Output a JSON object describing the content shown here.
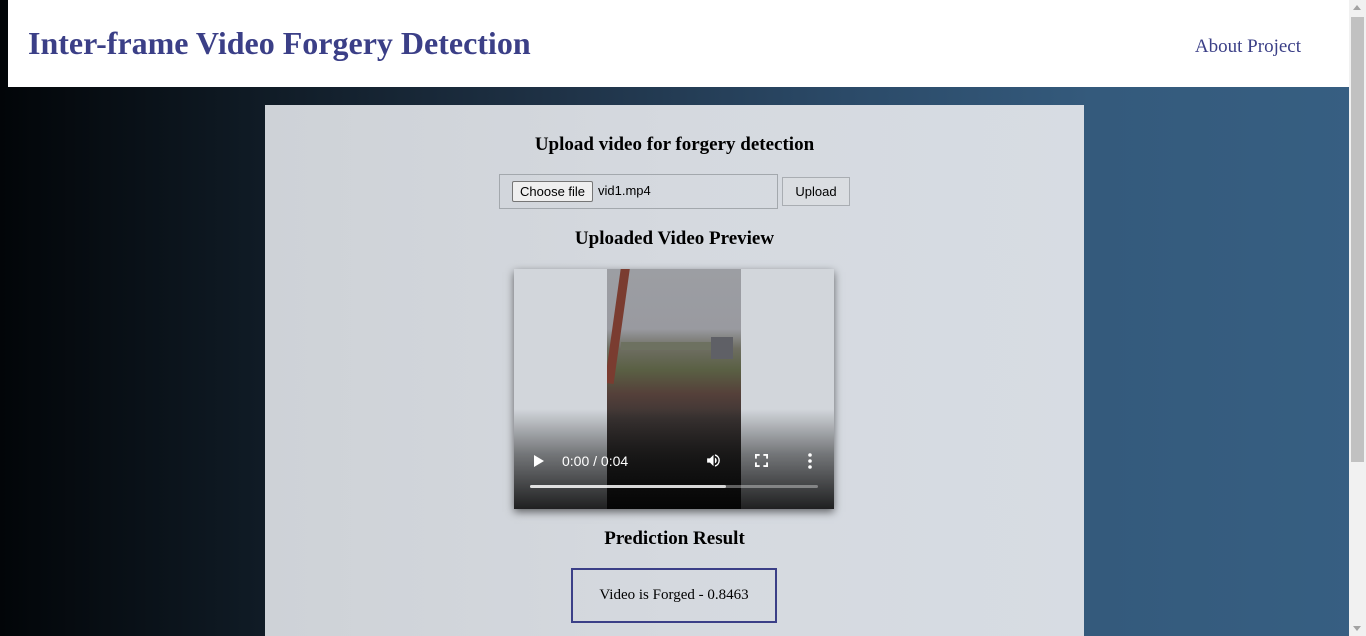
{
  "header": {
    "title": "Inter-frame Video Forgery Detection",
    "about_link": "About Project"
  },
  "upload": {
    "heading": "Upload video for forgery detection",
    "choose_file_label": "Choose file",
    "selected_file": "vid1.mp4",
    "upload_button": "Upload"
  },
  "preview": {
    "heading": "Uploaded Video Preview",
    "time_display": "0:00 / 0:04",
    "buffered_fraction": 0.68
  },
  "result": {
    "heading": "Prediction Result",
    "text": "Video is Forged - 0.8463"
  },
  "colors": {
    "title": "#3b3f87",
    "result_border": "#3b3f87",
    "card_background": "#d5d9df"
  },
  "icons": [
    "play-icon",
    "volume-icon",
    "fullscreen-icon",
    "more-options-icon"
  ]
}
